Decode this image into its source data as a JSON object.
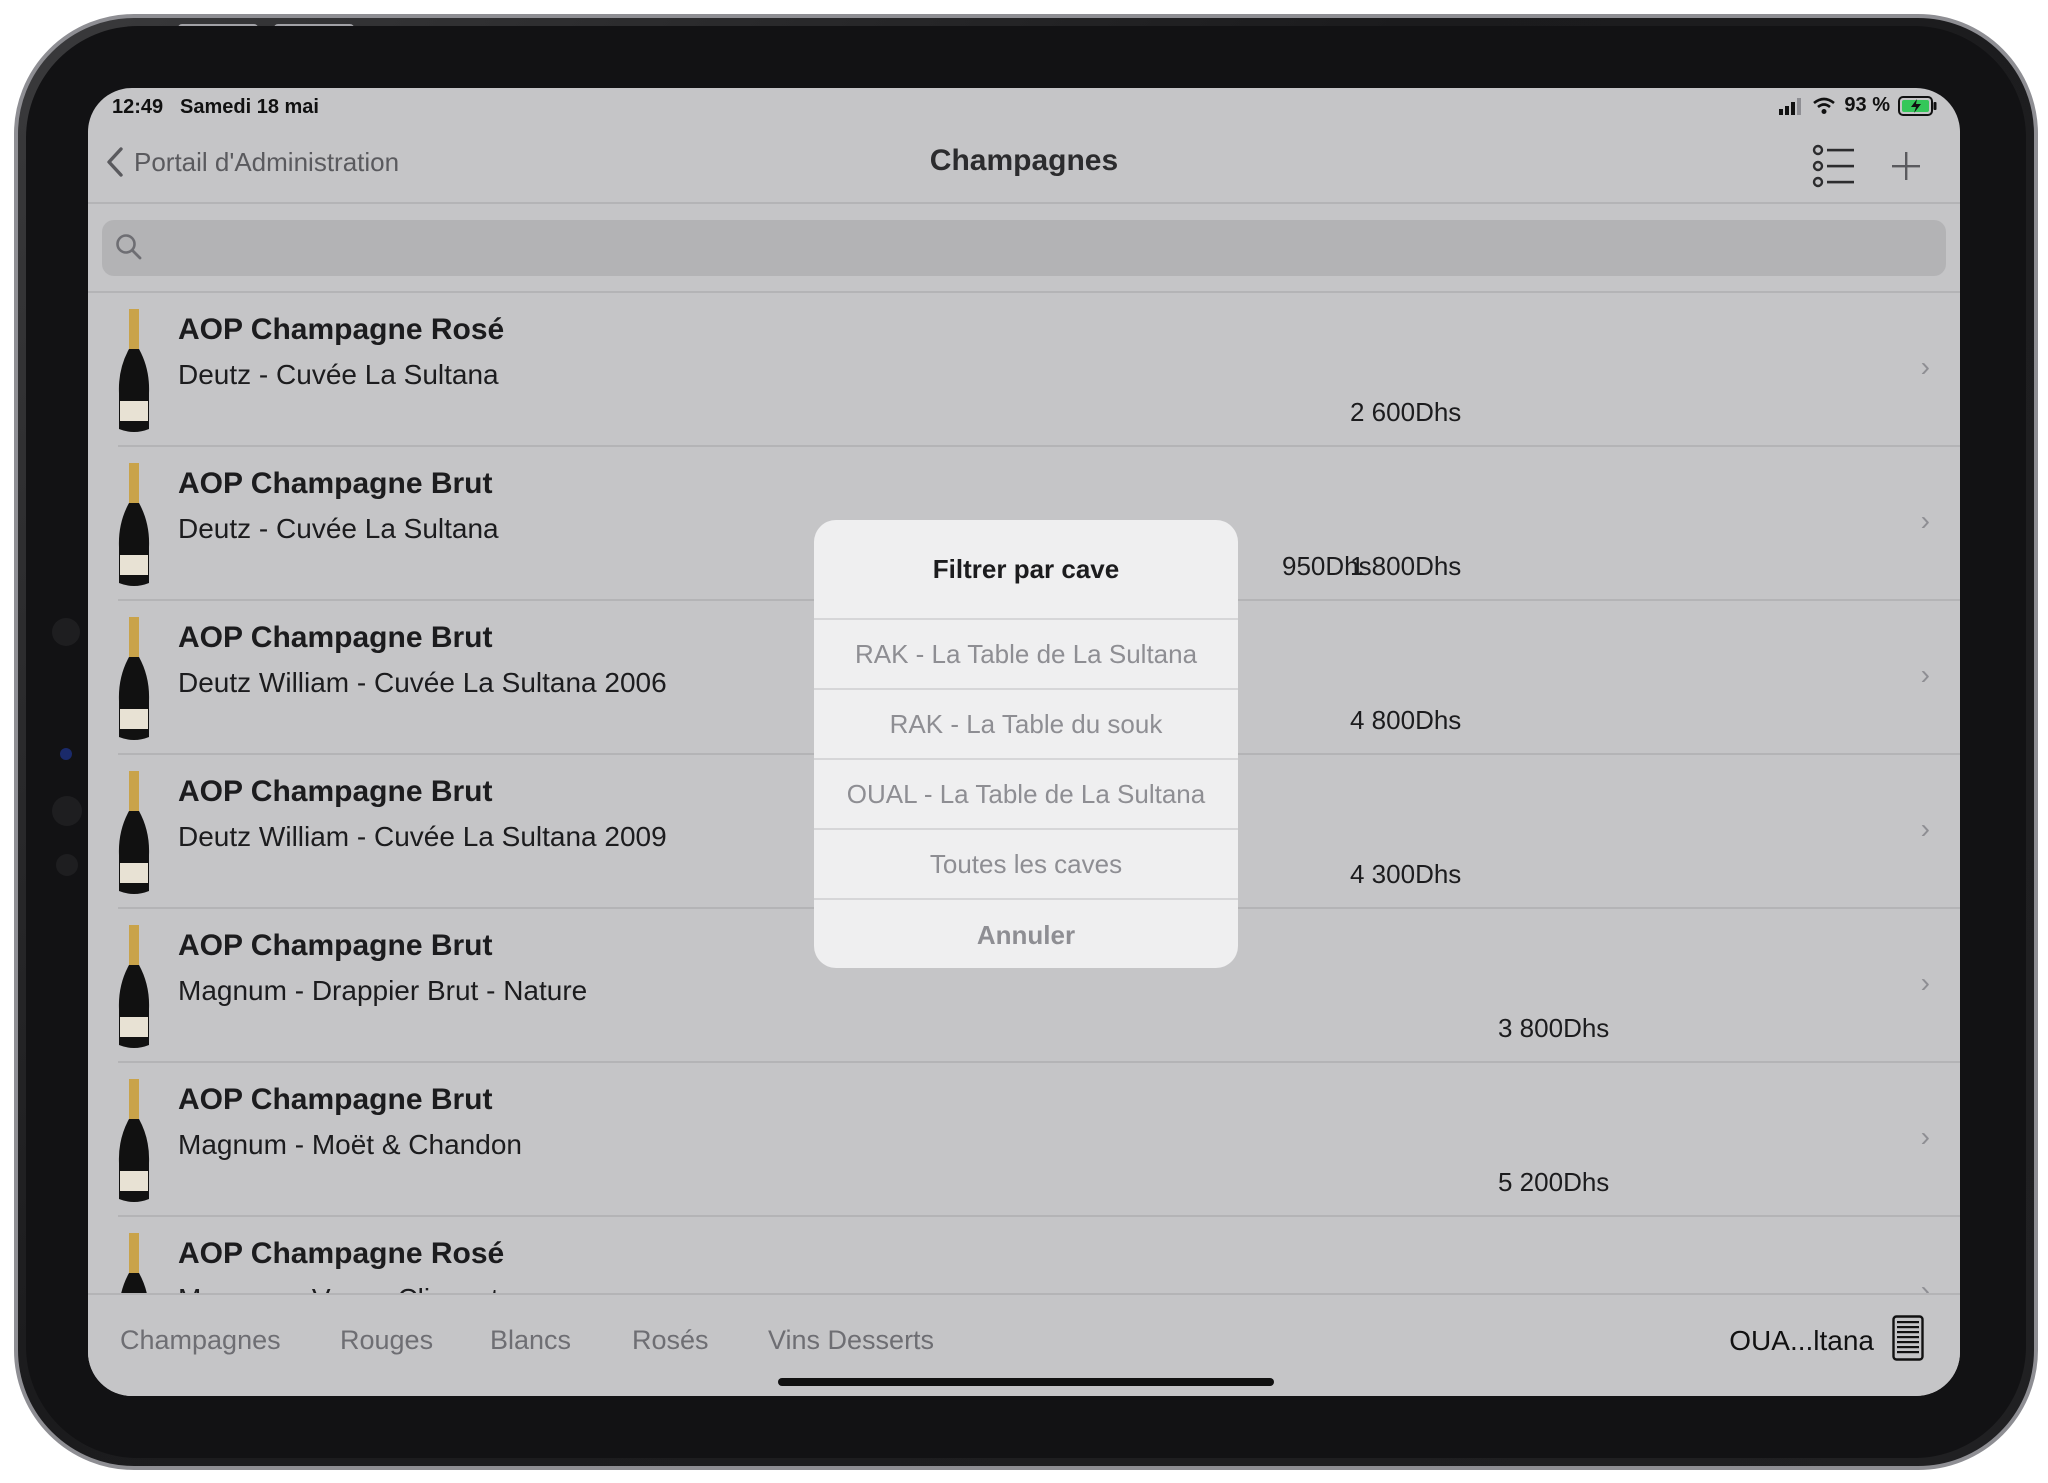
{
  "status": {
    "time": "12:49",
    "date": "Samedi 18 mai",
    "battery": "93 %"
  },
  "nav": {
    "back_label": "Portail d'Administration",
    "title": "Champagnes"
  },
  "search": {
    "placeholder": ""
  },
  "rows": [
    {
      "title": "AOP Champagne Rosé",
      "sub": "Deutz - Cuvée La Sultana",
      "price1": "",
      "price2": "2 600Dhs",
      "price3": ""
    },
    {
      "title": "AOP Champagne Brut",
      "sub": "Deutz - Cuvée La Sultana",
      "price1": "950Dhs",
      "price2": "1 800Dhs",
      "price3": ""
    },
    {
      "title": "AOP Champagne Brut",
      "sub": "Deutz William - Cuvée La Sultana 2006",
      "price1": "",
      "price2": "4 800Dhs",
      "price3": ""
    },
    {
      "title": "AOP Champagne Brut",
      "sub": "Deutz William - Cuvée La Sultana 2009",
      "price1": "",
      "price2": "4 300Dhs",
      "price3": ""
    },
    {
      "title": "AOP Champagne Brut",
      "sub": "Magnum - Drappier Brut - Nature",
      "price1": "",
      "price2": "",
      "price3": "3 800Dhs"
    },
    {
      "title": "AOP Champagne Brut",
      "sub": "Magnum - Moët & Chandon",
      "price1": "",
      "price2": "",
      "price3": "5 200Dhs"
    },
    {
      "title": "AOP Champagne Rosé",
      "sub": "Magnum - Veuve Clicquot",
      "price1": "",
      "price2": "",
      "price3": ""
    }
  ],
  "chevron": "›",
  "tabs": [
    "Champagnes",
    "Rouges",
    "Blancs",
    "Rosés",
    "Vins Desserts"
  ],
  "store_label": "OUA...ltana",
  "sheet": {
    "title": "Filtrer par cave",
    "options": [
      "RAK - La Table de La Sultana",
      "RAK - La Table du souk",
      "OUAL - La Table de La Sultana",
      "Toutes les caves"
    ],
    "cancel": "Annuler"
  },
  "colors": {
    "screen_dim": "#c5c5c7",
    "sheet_bg": "#efeff0",
    "battery_green": "#34c759"
  }
}
